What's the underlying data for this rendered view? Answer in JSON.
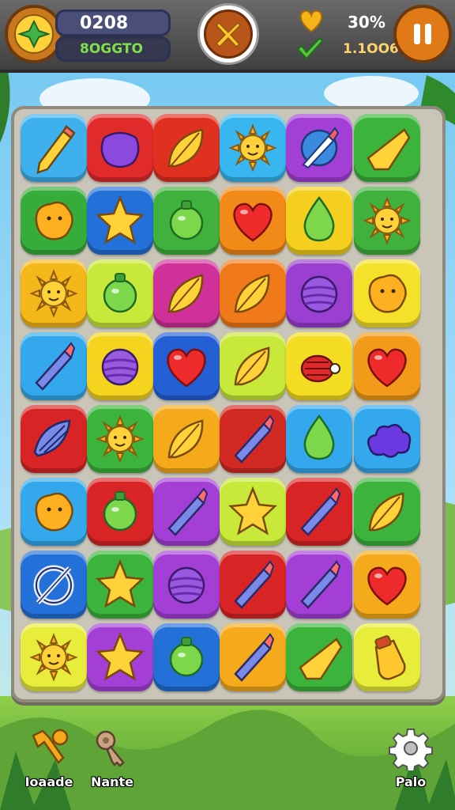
{
  "hud": {
    "score_value": "0208",
    "sub_value": "8OGGTO",
    "percent_value": "30%",
    "moves_value": "1.1OO6",
    "center_icon": "close-x-icon",
    "pause_icon": "pause-icon"
  },
  "board": {
    "rows": [
      [
        {
          "color": "#3fb0ee",
          "icon": "pencil-icon"
        },
        {
          "color": "#e12a2a",
          "icon": "purple-blob-icon"
        },
        {
          "color": "#e03020",
          "icon": "leaf-icon"
        },
        {
          "color": "#37b6f0",
          "icon": "sun-icon"
        },
        {
          "color": "#a43fd6",
          "icon": "brush-icon"
        },
        {
          "color": "#3cb43c",
          "icon": "crystal-icon"
        }
      ],
      [
        {
          "color": "#36ad3a",
          "icon": "blob-icon"
        },
        {
          "color": "#2370d8",
          "icon": "star-icon"
        },
        {
          "color": "#3fb13c",
          "icon": "bulb-icon"
        },
        {
          "color": "#f28a18",
          "icon": "heart-icon"
        },
        {
          "color": "#f4cf1e",
          "icon": "drop-icon"
        },
        {
          "color": "#3fb13c",
          "icon": "sun-icon"
        }
      ],
      [
        {
          "color": "#f4b81a",
          "icon": "sun-icon"
        },
        {
          "color": "#c8e83a",
          "icon": "bulb-icon"
        },
        {
          "color": "#d0309a",
          "icon": "leaf-icon"
        },
        {
          "color": "#f07a1a",
          "icon": "leaf-icon"
        },
        {
          "color": "#9a3fd0",
          "icon": "ball-icon"
        },
        {
          "color": "#f4e22a",
          "icon": "blob-icon"
        }
      ],
      [
        {
          "color": "#33a8ec",
          "icon": "crayon-icon"
        },
        {
          "color": "#f4d41e",
          "icon": "ball-icon"
        },
        {
          "color": "#2360d6",
          "icon": "heart-icon"
        },
        {
          "color": "#c8e83a",
          "icon": "leaf-icon"
        },
        {
          "color": "#f4dc22",
          "icon": "bug-icon"
        },
        {
          "color": "#f29a1a",
          "icon": "heart-icon"
        }
      ],
      [
        {
          "color": "#d82424",
          "icon": "shell-icon"
        },
        {
          "color": "#3cb43c",
          "icon": "sun-icon"
        },
        {
          "color": "#f4aa1a",
          "icon": "leaf-icon"
        },
        {
          "color": "#d22a22",
          "icon": "crayon-icon"
        },
        {
          "color": "#33a8ec",
          "icon": "drop-icon"
        },
        {
          "color": "#33a8ec",
          "icon": "cloud-icon"
        }
      ],
      [
        {
          "color": "#33a8ec",
          "icon": "blob-icon"
        },
        {
          "color": "#d82424",
          "icon": "bulb-icon"
        },
        {
          "color": "#a43fd6",
          "icon": "crayon-icon"
        },
        {
          "color": "#c8e83a",
          "icon": "star-icon"
        },
        {
          "color": "#d82424",
          "icon": "crayon-icon"
        },
        {
          "color": "#3cb43c",
          "icon": "leaf-icon"
        }
      ],
      [
        {
          "color": "#2370d8",
          "icon": "ring-icon"
        },
        {
          "color": "#3cb43c",
          "icon": "star-icon"
        },
        {
          "color": "#a43fd6",
          "icon": "ball-icon"
        },
        {
          "color": "#d82424",
          "icon": "crayon-icon"
        },
        {
          "color": "#a43fd6",
          "icon": "crayon-icon"
        },
        {
          "color": "#f4aa1a",
          "icon": "heart-icon"
        }
      ],
      [
        {
          "color": "#e8ec3a",
          "icon": "sun-icon"
        },
        {
          "color": "#a43fd6",
          "icon": "star-icon"
        },
        {
          "color": "#2370d8",
          "icon": "bulb-icon"
        },
        {
          "color": "#f4aa1a",
          "icon": "crayon-icon"
        },
        {
          "color": "#3cb43c",
          "icon": "crystal-icon"
        },
        {
          "color": "#e8ec3a",
          "icon": "bottle-icon"
        }
      ]
    ]
  },
  "bottom": {
    "left_label": "Ioaade",
    "middle_label": "Nante",
    "right_label": "Palo"
  }
}
